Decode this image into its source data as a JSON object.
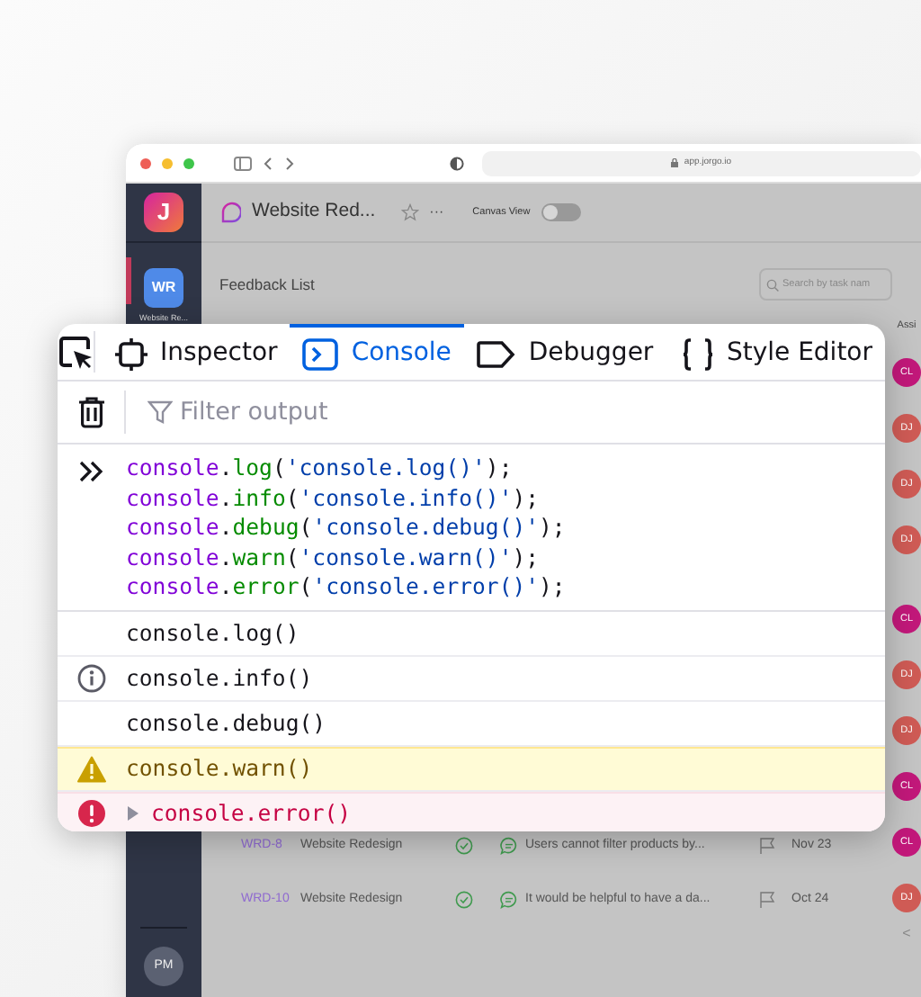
{
  "browser": {
    "url": "app.jorgo.io"
  },
  "sidebar": {
    "logo": "J",
    "workspaces": [
      {
        "initials": "WR",
        "label": "Website Re...",
        "selected": true
      }
    ],
    "user": "PM"
  },
  "header": {
    "title": "Website Red...",
    "more": "···",
    "canvas_view": {
      "label": "Canvas View",
      "on": false
    }
  },
  "page": {
    "title": "Feedback List",
    "search": {
      "placeholder": "Search by task nam"
    },
    "column_header": "Assi"
  },
  "rows": [
    {
      "id": "WRD-8",
      "project": "Website Redesign",
      "text": "Users cannot filter products by...",
      "date": "Nov 23"
    },
    {
      "id": "WRD-10",
      "project": "Website Redesign",
      "text": "It would be helpful to have a da...",
      "date": "Oct 24"
    }
  ],
  "assignees": [
    {
      "initials": "CL",
      "color": "#c2187a"
    },
    {
      "initials": "DJ",
      "color": "#cf5b55"
    },
    {
      "initials": "DJ",
      "color": "#cf5b55"
    },
    {
      "initials": "DJ",
      "color": "#cf5b55"
    },
    {
      "initials": "CL",
      "color": "#c2187a"
    },
    {
      "initials": "DJ",
      "color": "#cf5b55"
    },
    {
      "initials": "DJ",
      "color": "#cf5b55"
    },
    {
      "initials": "CL",
      "color": "#c2187a"
    },
    {
      "initials": "CL",
      "color": "#c2187a"
    },
    {
      "initials": "DJ",
      "color": "#cf5b55"
    }
  ],
  "pager": "<",
  "devtools": {
    "tabs": [
      {
        "label": "Inspector",
        "kind": "inspector",
        "selected": false
      },
      {
        "label": "Console",
        "kind": "console",
        "selected": true
      },
      {
        "label": "Debugger",
        "kind": "debugger",
        "selected": false
      },
      {
        "label": "Style Editor",
        "kind": "style",
        "selected": false
      }
    ],
    "filter": {
      "placeholder": "Filter output"
    },
    "input": [
      {
        "obj": "console",
        "dot": ".",
        "method": "log",
        "open": "(",
        "arg": "'console.log()'",
        "close": ");"
      },
      {
        "obj": "console",
        "dot": ".",
        "method": "info",
        "open": "(",
        "arg": "'console.info()'",
        "close": ");"
      },
      {
        "obj": "console",
        "dot": ".",
        "method": "debug",
        "open": "(",
        "arg": "'console.debug()'",
        "close": ");"
      },
      {
        "obj": "console",
        "dot": ".",
        "method": "warn",
        "open": "(",
        "arg": "'console.warn()'",
        "close": ");"
      },
      {
        "obj": "console",
        "dot": ".",
        "method": "error",
        "open": "(",
        "arg": "'console.error()'",
        "close": ");"
      }
    ],
    "messages": [
      {
        "kind": "log",
        "text": "console.log()",
        "expandable": false
      },
      {
        "kind": "info",
        "text": "console.info()",
        "expandable": false
      },
      {
        "kind": "debug",
        "text": "console.debug()",
        "expandable": false
      },
      {
        "kind": "warn",
        "text": "console.warn()",
        "expandable": false
      },
      {
        "kind": "error",
        "text": "console.error()",
        "expandable": true
      }
    ]
  }
}
